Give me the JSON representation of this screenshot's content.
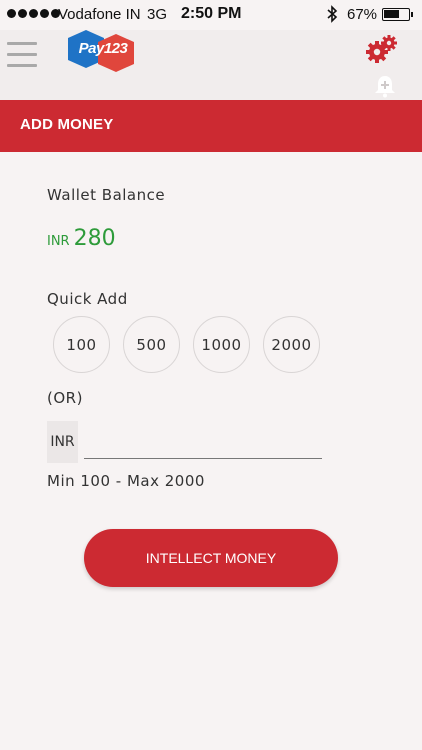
{
  "status_bar": {
    "carrier": "Vodafone IN",
    "network": "3G",
    "time": "2:50 PM",
    "battery_percent": "67%",
    "battery_level": 0.67
  },
  "header": {
    "logo_text": "Pay123",
    "menu_icon": "hamburger-icon",
    "settings_icon": "gears-icon",
    "notification_icon": "bell-add-icon"
  },
  "page": {
    "title": "ADD MONEY"
  },
  "wallet": {
    "label": "Wallet Balance",
    "currency": "INR",
    "amount": "280"
  },
  "quick_add": {
    "label": "Quick Add",
    "amounts": [
      "100",
      "500",
      "1000",
      "2000"
    ]
  },
  "or_label": "(OR)",
  "amount_input": {
    "currency": "INR",
    "value": "",
    "placeholder": ""
  },
  "limits_text": "Min 100 - Max 2000",
  "submit_label": "INTELLECT MONEY",
  "colors": {
    "brand_red": "#cc2a32",
    "balance_green": "#2e9b3a",
    "background": "#f7f3f3"
  }
}
